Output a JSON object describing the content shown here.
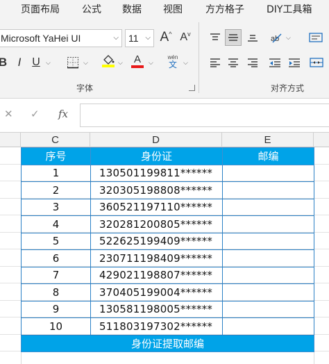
{
  "menu": {
    "items": [
      "页面布局",
      "公式",
      "数据",
      "视图",
      "方方格子",
      "DIY工具箱"
    ]
  },
  "ribbon": {
    "font_name": "Microsoft YaHei UI",
    "font_size": "11",
    "grow_font": "A",
    "shrink_font": "A",
    "bold": "B",
    "italic": "I",
    "underline": "U",
    "fill_letter": "A",
    "font_color_letter": "A",
    "phonetic_top": "wén",
    "phonetic_bottom": "文",
    "font_group_label": "字体",
    "align_group_label": "对齐方式",
    "fill_color": "#ffff00",
    "font_color": "#ff0000"
  },
  "formula_bar": {
    "cancel_glyph": "✕",
    "enter_glyph": "✓",
    "fx_label": "fx",
    "value": ""
  },
  "columns": [
    "C",
    "D",
    "E"
  ],
  "table": {
    "headers": [
      "序号",
      "身份证",
      "邮编"
    ],
    "rows": [
      {
        "no": "1",
        "id": "130501199811******",
        "zip": ""
      },
      {
        "no": "2",
        "id": "320305198808******",
        "zip": ""
      },
      {
        "no": "3",
        "id": "360521197110******",
        "zip": ""
      },
      {
        "no": "4",
        "id": "320281200805******",
        "zip": ""
      },
      {
        "no": "5",
        "id": "522625199409******",
        "zip": ""
      },
      {
        "no": "6",
        "id": "230711198409******",
        "zip": ""
      },
      {
        "no": "7",
        "id": "429021198807******",
        "zip": ""
      },
      {
        "no": "8",
        "id": "370405199004******",
        "zip": ""
      },
      {
        "no": "9",
        "id": "130581198005******",
        "zip": ""
      },
      {
        "no": "10",
        "id": "511803197302******",
        "zip": ""
      }
    ],
    "footer": "身份证提取邮编",
    "header_color": "#00a3e8"
  }
}
